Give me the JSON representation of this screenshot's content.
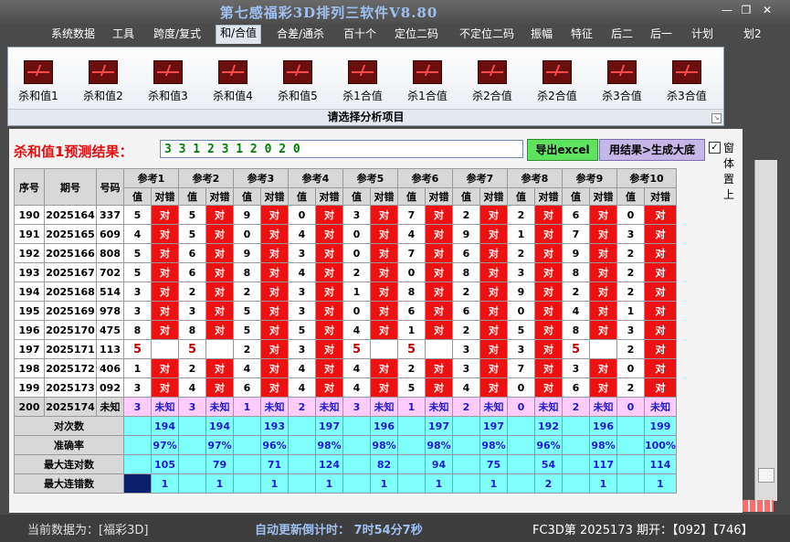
{
  "window": {
    "title": "第七感福彩3D排列三软件V8.80",
    "title_right": "划2"
  },
  "menu": [
    "系统数据",
    "工具",
    "跨度/复式",
    "和/合值",
    "合差/通杀",
    "百十个",
    "定位二码",
    "不定位二码",
    "振幅",
    "特征",
    "后二",
    "后一",
    "计划"
  ],
  "menu_active": 3,
  "ribbon": {
    "buttons": [
      "杀和值1",
      "杀和值2",
      "杀和值3",
      "杀和值4",
      "杀和值5",
      "杀1合值",
      "杀1合值",
      "杀2合值",
      "杀2合值",
      "杀3合值",
      "杀3合值"
    ],
    "caption": "请选择分析项目"
  },
  "prediction": {
    "label": "杀和值1预测结果：",
    "value": "3 3 1 2 3 1 2 0 2 0"
  },
  "buttons": {
    "export": "导出excel",
    "generate": "用结果>生成大底"
  },
  "checkbox": {
    "label": "窗体置上",
    "checked": "✓"
  },
  "table": {
    "headers": {
      "seq": "序号",
      "period": "期号",
      "number": "号码",
      "value": "值",
      "judge": "对错"
    },
    "refs": [
      "参考1",
      "参考2",
      "参考3",
      "参考4",
      "参考5",
      "参考6",
      "参考7",
      "参考8",
      "参考9",
      "参考10"
    ],
    "rows": [
      {
        "seq": "190",
        "period": "2025164",
        "number": "337",
        "vals": [
          "5",
          "5",
          "9",
          "0",
          "3",
          "7",
          "2",
          "2",
          "6",
          "0"
        ]
      },
      {
        "seq": "191",
        "period": "2025165",
        "number": "609",
        "vals": [
          "4",
          "5",
          "0",
          "4",
          "0",
          "4",
          "9",
          "1",
          "7",
          "3"
        ]
      },
      {
        "seq": "192",
        "period": "2025166",
        "number": "808",
        "vals": [
          "5",
          "6",
          "9",
          "3",
          "0",
          "7",
          "6",
          "2",
          "9",
          "2"
        ]
      },
      {
        "seq": "193",
        "period": "2025167",
        "number": "702",
        "vals": [
          "5",
          "6",
          "8",
          "4",
          "2",
          "0",
          "8",
          "3",
          "8",
          "2"
        ]
      },
      {
        "seq": "194",
        "period": "2025168",
        "number": "514",
        "vals": [
          "3",
          "2",
          "2",
          "3",
          "1",
          "8",
          "2",
          "9",
          "2",
          "2"
        ]
      },
      {
        "seq": "195",
        "period": "2025169",
        "number": "978",
        "vals": [
          "3",
          "3",
          "5",
          "3",
          "0",
          "6",
          "6",
          "0",
          "4",
          "1"
        ]
      },
      {
        "seq": "196",
        "period": "2025170",
        "number": "475",
        "vals": [
          "8",
          "8",
          "5",
          "5",
          "4",
          "1",
          "2",
          "5",
          "8",
          "3"
        ]
      },
      {
        "seq": "197",
        "period": "2025171",
        "number": "113",
        "vals": [
          "5",
          "5",
          "2",
          "3",
          "5",
          "5",
          "3",
          "3",
          "5",
          "2"
        ],
        "miss": [
          0,
          1,
          4,
          5,
          8
        ]
      },
      {
        "seq": "198",
        "period": "2025172",
        "number": "406",
        "vals": [
          "1",
          "2",
          "4",
          "4",
          "4",
          "2",
          "3",
          "7",
          "3",
          "0"
        ]
      },
      {
        "seq": "199",
        "period": "2025173",
        "number": "092",
        "vals": [
          "3",
          "4",
          "6",
          "4",
          "4",
          "5",
          "4",
          "0",
          "6",
          "2"
        ]
      }
    ],
    "mark": "对",
    "pending": {
      "seq": "200",
      "period": "2025174",
      "number": "未知",
      "vals": [
        "3",
        "3",
        "1",
        "2",
        "3",
        "1",
        "2",
        "0",
        "2",
        "0"
      ],
      "judge": "未知"
    },
    "stats": [
      {
        "label": "对次数",
        "vals": [
          "194",
          "194",
          "193",
          "197",
          "196",
          "197",
          "197",
          "192",
          "196",
          "199"
        ]
      },
      {
        "label": "准确率",
        "vals": [
          "97%",
          "97%",
          "96%",
          "98%",
          "98%",
          "98%",
          "98%",
          "96%",
          "98%",
          "100%"
        ]
      },
      {
        "label": "最大连对数",
        "vals": [
          "105",
          "79",
          "71",
          "124",
          "82",
          "94",
          "75",
          "54",
          "117",
          "114"
        ]
      },
      {
        "label": "最大连错数",
        "vals": [
          "1",
          "1",
          "1",
          "1",
          "1",
          "1",
          "1",
          "2",
          "1",
          "1"
        ]
      }
    ]
  },
  "status": {
    "left": "当前数据为：[福彩3D]",
    "mid": "自动更新倒计时：   7时54分7秒",
    "right": "FC3D第  2025173  期开：【092】【746】"
  },
  "colors": {
    "error": "#ee1111",
    "pending": "#ffccff",
    "stats": "#80ffff",
    "accent_blue": "#1a1ad8"
  }
}
